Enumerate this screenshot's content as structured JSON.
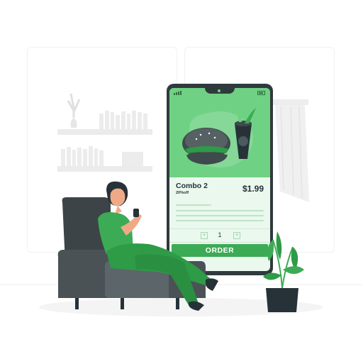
{
  "product": {
    "name": "Combo 2",
    "discount": "20%off",
    "price": "$1.99"
  },
  "quantity": {
    "minus_label": "+",
    "value": "1",
    "plus_label": "+"
  },
  "actions": {
    "order_label": "ORDER"
  },
  "colors": {
    "accent": "#3cab55",
    "accent_light": "#6fd183",
    "screen_bg": "#eaf8ee",
    "dark": "#263238",
    "sofa": "#3d4448"
  },
  "icons": [
    "signal-icon",
    "battery-icon",
    "burger-icon",
    "drink-cup-icon",
    "plant-icon",
    "vase-icon",
    "books-icon",
    "sofa-icon",
    "person-icon"
  ]
}
